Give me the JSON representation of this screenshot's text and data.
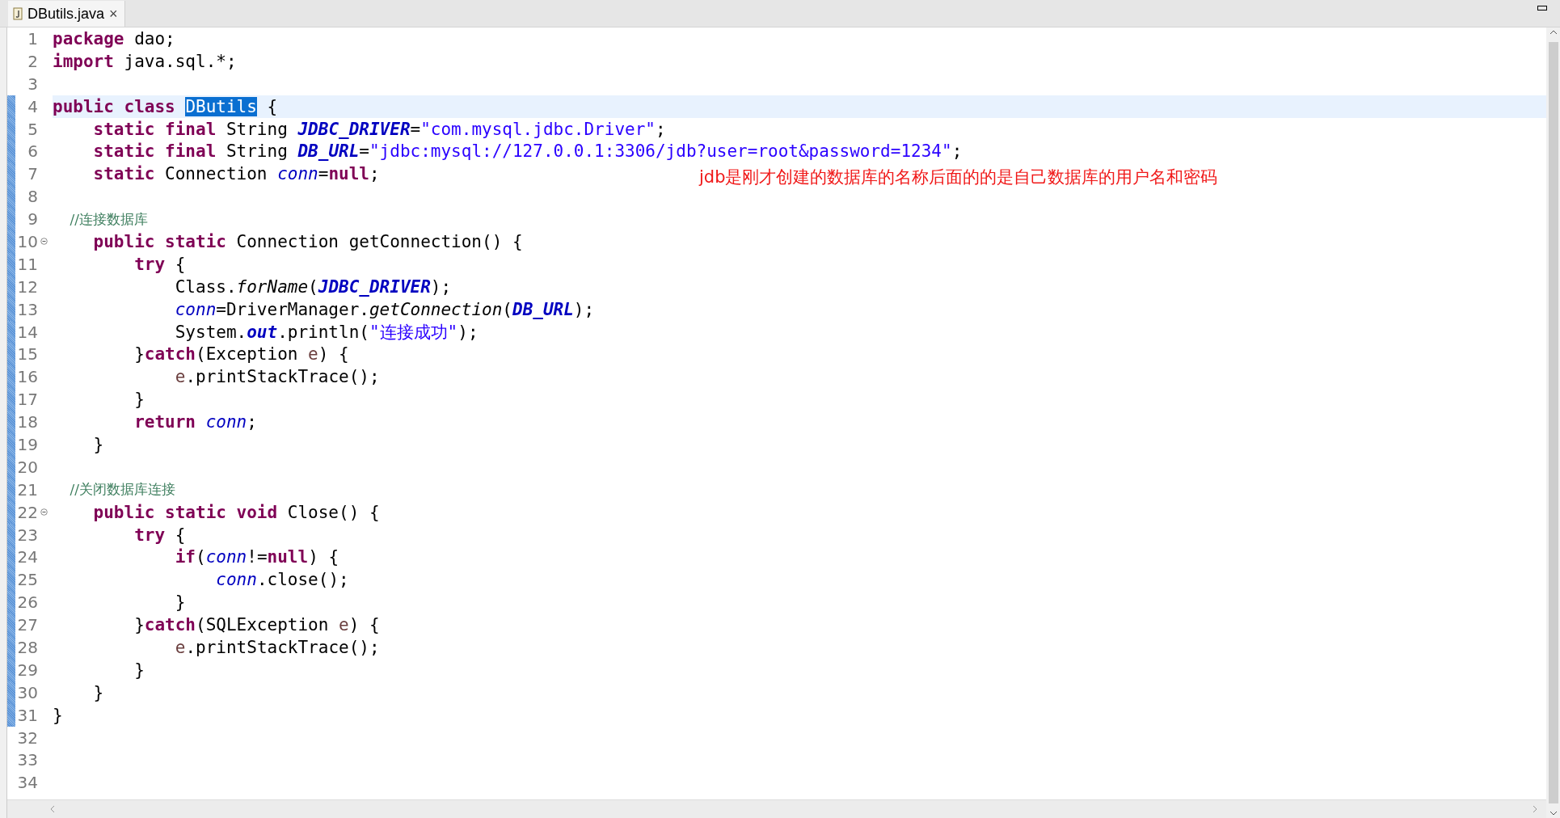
{
  "tab": {
    "label": "DButils.java",
    "selected": true,
    "close": "×"
  },
  "lines": [
    {
      "number": "1",
      "fold": false,
      "in_range": false,
      "current": false,
      "tokens": [
        {
          "kind": "keyword",
          "text": "package"
        },
        {
          "kind": "plain",
          "text": " dao;"
        }
      ]
    },
    {
      "number": "2",
      "fold": false,
      "in_range": false,
      "current": false,
      "tokens": [
        {
          "kind": "keyword",
          "text": "import"
        },
        {
          "kind": "plain",
          "text": " java.sql.*;"
        }
      ]
    },
    {
      "number": "3",
      "fold": false,
      "in_range": false,
      "current": false
    },
    {
      "number": "4",
      "fold": false,
      "in_range": true,
      "current": true,
      "tokens": [
        {
          "kind": "keyword",
          "text": "public class "
        },
        {
          "kind": "selection",
          "text": "DButils"
        },
        {
          "kind": "plain",
          "text": " {"
        }
      ]
    },
    {
      "number": "5",
      "fold": false,
      "in_range": true,
      "current": false,
      "tokens": [
        {
          "kind": "keyword",
          "text": "    static final"
        },
        {
          "kind": "plain",
          "text": " String "
        },
        {
          "kind": "field",
          "text": "JDBC_DRIVER"
        },
        {
          "kind": "plain",
          "text": "="
        },
        {
          "kind": "string",
          "text": "\"com.mysql.jdbc.Driver\""
        },
        {
          "kind": "plain",
          "text": ";"
        }
      ]
    },
    {
      "number": "6",
      "fold": false,
      "in_range": true,
      "current": false,
      "tokens": [
        {
          "kind": "keyword",
          "text": "    static final"
        },
        {
          "kind": "plain",
          "text": " String "
        },
        {
          "kind": "field",
          "text": "DB_URL"
        },
        {
          "kind": "plain",
          "text": "="
        },
        {
          "kind": "string",
          "text": "\"jdbc:mysql://127.0.0.1:3306/jdb?user=root&password=1234\""
        },
        {
          "kind": "plain",
          "text": ";"
        }
      ]
    },
    {
      "number": "7",
      "fold": false,
      "in_range": true,
      "current": false,
      "tokens": [
        {
          "kind": "keyword",
          "text": "    static"
        },
        {
          "kind": "plain",
          "text": " Connection "
        },
        {
          "kind": "static_var",
          "text": "conn"
        },
        {
          "kind": "plain",
          "text": "="
        },
        {
          "kind": "keyword",
          "text": "null"
        },
        {
          "kind": "plain",
          "text": ";"
        }
      ],
      "note": "jdb是刚才创建的数据库的名称后面的的是自己数据库的用户名和密码"
    },
    {
      "number": "8",
      "fold": false,
      "in_range": true,
      "current": false
    },
    {
      "number": "9",
      "fold": false,
      "in_range": true,
      "current": false,
      "tokens": [
        {
          "kind": "comment",
          "text": "    //连接数据库"
        }
      ]
    },
    {
      "number": "10",
      "fold": true,
      "in_range": true,
      "current": false,
      "tokens": [
        {
          "kind": "keyword",
          "text": "    public static"
        },
        {
          "kind": "plain",
          "text": " Connection getConnection() {"
        }
      ]
    },
    {
      "number": "11",
      "fold": false,
      "in_range": true,
      "current": false,
      "tokens": [
        {
          "kind": "keyword",
          "text": "        try"
        },
        {
          "kind": "plain",
          "text": " {"
        }
      ]
    },
    {
      "number": "12",
      "fold": false,
      "in_range": true,
      "current": false,
      "tokens": [
        {
          "kind": "plain",
          "text": "            Class."
        },
        {
          "kind": "static_call",
          "text": "forName"
        },
        {
          "kind": "plain",
          "text": "("
        },
        {
          "kind": "field",
          "text": "JDBC_DRIVER"
        },
        {
          "kind": "plain",
          "text": ");"
        }
      ]
    },
    {
      "number": "13",
      "fold": false,
      "in_range": true,
      "current": false,
      "tokens": [
        {
          "kind": "static_var",
          "text": "            conn"
        },
        {
          "kind": "plain",
          "text": "=DriverManager."
        },
        {
          "kind": "static_call",
          "text": "getConnection"
        },
        {
          "kind": "plain",
          "text": "("
        },
        {
          "kind": "field",
          "text": "DB_URL"
        },
        {
          "kind": "plain",
          "text": ");"
        }
      ]
    },
    {
      "number": "14",
      "fold": false,
      "in_range": true,
      "current": false,
      "tokens": [
        {
          "kind": "plain",
          "text": "            System."
        },
        {
          "kind": "field",
          "text": "out"
        },
        {
          "kind": "plain",
          "text": ".println("
        },
        {
          "kind": "string",
          "text": "\"连接成功\""
        },
        {
          "kind": "plain",
          "text": ");"
        }
      ]
    },
    {
      "number": "15",
      "fold": false,
      "in_range": true,
      "current": false,
      "tokens": [
        {
          "kind": "plain",
          "text": "        }"
        },
        {
          "kind": "keyword",
          "text": "catch"
        },
        {
          "kind": "plain",
          "text": "(Exception "
        },
        {
          "kind": "param",
          "text": "e"
        },
        {
          "kind": "plain",
          "text": ") {"
        }
      ]
    },
    {
      "number": "16",
      "fold": false,
      "in_range": true,
      "current": false,
      "tokens": [
        {
          "kind": "param",
          "text": "            e"
        },
        {
          "kind": "plain",
          "text": ".printStackTrace();"
        }
      ]
    },
    {
      "number": "17",
      "fold": false,
      "in_range": true,
      "current": false,
      "tokens": [
        {
          "kind": "plain",
          "text": "        }"
        }
      ]
    },
    {
      "number": "18",
      "fold": false,
      "in_range": true,
      "current": false,
      "tokens": [
        {
          "kind": "keyword",
          "text": "        return"
        },
        {
          "kind": "static_var",
          "text": " conn"
        },
        {
          "kind": "plain",
          "text": ";"
        }
      ]
    },
    {
      "number": "19",
      "fold": false,
      "in_range": true,
      "current": false,
      "tokens": [
        {
          "kind": "plain",
          "text": "    }"
        }
      ]
    },
    {
      "number": "20",
      "fold": false,
      "in_range": true,
      "current": false
    },
    {
      "number": "21",
      "fold": false,
      "in_range": true,
      "current": false,
      "tokens": [
        {
          "kind": "comment",
          "text": "    //关闭数据库连接"
        }
      ]
    },
    {
      "number": "22",
      "fold": true,
      "in_range": true,
      "current": false,
      "tokens": [
        {
          "kind": "keyword",
          "text": "    public static void"
        },
        {
          "kind": "plain",
          "text": " Close() {"
        }
      ]
    },
    {
      "number": "23",
      "fold": false,
      "in_range": true,
      "current": false,
      "tokens": [
        {
          "kind": "keyword",
          "text": "        try"
        },
        {
          "kind": "plain",
          "text": " {"
        }
      ]
    },
    {
      "number": "24",
      "fold": false,
      "in_range": true,
      "current": false,
      "tokens": [
        {
          "kind": "keyword",
          "text": "            if"
        },
        {
          "kind": "plain",
          "text": "("
        },
        {
          "kind": "static_var",
          "text": "conn"
        },
        {
          "kind": "plain",
          "text": "!="
        },
        {
          "kind": "keyword",
          "text": "null"
        },
        {
          "kind": "plain",
          "text": ") {"
        }
      ]
    },
    {
      "number": "25",
      "fold": false,
      "in_range": true,
      "current": false,
      "tokens": [
        {
          "kind": "static_var",
          "text": "                conn"
        },
        {
          "kind": "plain",
          "text": ".close();"
        }
      ]
    },
    {
      "number": "26",
      "fold": false,
      "in_range": true,
      "current": false,
      "tokens": [
        {
          "kind": "plain",
          "text": "            }"
        }
      ]
    },
    {
      "number": "27",
      "fold": false,
      "in_range": true,
      "current": false,
      "tokens": [
        {
          "kind": "plain",
          "text": "        }"
        },
        {
          "kind": "keyword",
          "text": "catch"
        },
        {
          "kind": "plain",
          "text": "(SQLException "
        },
        {
          "kind": "param",
          "text": "e"
        },
        {
          "kind": "plain",
          "text": ") {"
        }
      ]
    },
    {
      "number": "28",
      "fold": false,
      "in_range": true,
      "current": false,
      "tokens": [
        {
          "kind": "param",
          "text": "            e"
        },
        {
          "kind": "plain",
          "text": ".printStackTrace();"
        }
      ]
    },
    {
      "number": "29",
      "fold": false,
      "in_range": true,
      "current": false,
      "tokens": [
        {
          "kind": "plain",
          "text": "        }"
        }
      ]
    },
    {
      "number": "30",
      "fold": false,
      "in_range": true,
      "current": false,
      "tokens": [
        {
          "kind": "plain",
          "text": "    }"
        }
      ]
    },
    {
      "number": "31",
      "fold": false,
      "in_range": true,
      "current": false,
      "tokens": [
        {
          "kind": "plain",
          "text": "}"
        }
      ]
    },
    {
      "number": "32",
      "fold": false,
      "in_range": false,
      "current": false
    },
    {
      "number": "33",
      "fold": false,
      "in_range": false,
      "current": false
    },
    {
      "number": "34",
      "fold": false,
      "in_range": false,
      "current": false
    }
  ]
}
